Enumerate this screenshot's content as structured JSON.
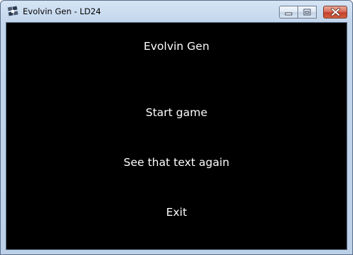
{
  "window": {
    "title": "Evolvin Gen - LD24",
    "icon": "app-window-icon"
  },
  "controls": {
    "minimize_icon": "minimize-icon",
    "maximize_icon": "maximize-icon",
    "close_icon": "close-icon"
  },
  "game": {
    "title": "Evolvin Gen",
    "menu": {
      "start": "Start game",
      "see_text": "See that text again",
      "exit": "Exit"
    }
  },
  "colors": {
    "background": "#000000",
    "text": "#ffffff",
    "close_button": "#c4412b"
  }
}
